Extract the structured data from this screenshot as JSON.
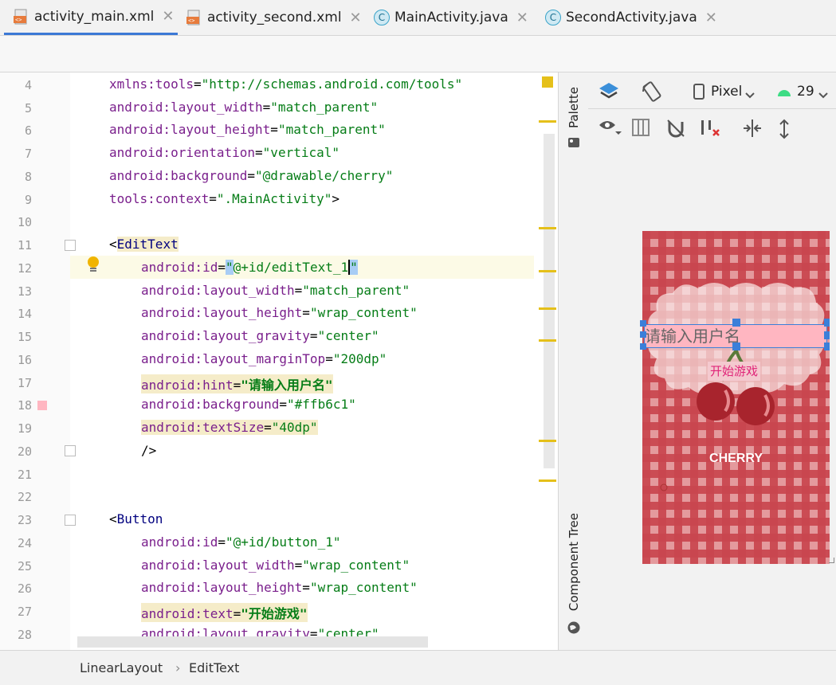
{
  "tabs": [
    {
      "label": "activity_main.xml",
      "icon": "xml-file-icon",
      "active": true
    },
    {
      "label": "activity_second.xml",
      "icon": "xml-file-icon",
      "active": false
    },
    {
      "label": "MainActivity.java",
      "icon": "java-class-icon",
      "active": false
    },
    {
      "label": "SecondActivity.java",
      "icon": "java-class-icon",
      "active": false
    }
  ],
  "tab_close": "✕",
  "class_glyph": "C",
  "line_numbers": [
    "4",
    "5",
    "6",
    "7",
    "8",
    "9",
    "10",
    "11",
    "12",
    "13",
    "14",
    "15",
    "16",
    "17",
    "18",
    "19",
    "20",
    "21",
    "22",
    "23",
    "24",
    "25",
    "26",
    "27",
    "28"
  ],
  "code": {
    "l4_attr": "xmlns:tools",
    "l4_val": "\"http://schemas.android.com/tools\"",
    "l5_attr": "android:layout_width",
    "l5_val": "\"match_parent\"",
    "l6_attr": "android:layout_height",
    "l6_val": "\"match_parent\"",
    "l7_attr": "android:orientation",
    "l7_val": "\"vertical\"",
    "l8_attr": "android:background",
    "l8_val": "\"@drawable/cherry\"",
    "l9_attr": "tools:context",
    "l9_val": "\".MainActivity\"",
    "l9_end": ">",
    "l11_open": "<",
    "l11_tag": "EditText",
    "l12_attr": "android:id",
    "l12_q1": "\"",
    "l12_val": "@+id/editText_1",
    "l12_q2": "\"",
    "l13_attr": "android:layout_width",
    "l13_val": "\"match_parent\"",
    "l14_attr": "android:layout_height",
    "l14_val": "\"wrap_content\"",
    "l15_attr": "android:layout_gravity",
    "l15_val": "\"center\"",
    "l16_attr": "android:layout_marginTop",
    "l16_val": "\"200dp\"",
    "l17_attr": "android:hint",
    "l17_val": "\"请输入用户名\"",
    "l18_attr": "android:background",
    "l18_val": "\"#ffb6c1\"",
    "l19_attr": "android:textSize",
    "l19_val": "\"40dp\"",
    "l20_close": "/>",
    "l23_open": "<",
    "l23_tag": "Button",
    "l24_attr": "android:id",
    "l24_val": "\"@+id/button_1\"",
    "l25_attr": "android:layout_width",
    "l25_val": "\"wrap_content\"",
    "l26_attr": "android:layout_height",
    "l26_val": "\"wrap_content\"",
    "l27_attr": "android:text",
    "l27_val": "\"开始游戏\"",
    "l28_attr": "android:layout_gravity",
    "l28_val": "\"center\"",
    "eq": "="
  },
  "sidebar": {
    "palette": "Palette",
    "component_tree": "Component Tree"
  },
  "design_toolbar": {
    "device": "Pixel",
    "api": "29"
  },
  "preview": {
    "edittext_hint": "请输入用户名",
    "button_text": "开始游戏",
    "brand": "CHERRY",
    "edittext_bg": "#ffb6c1",
    "gingham_color": "#c8454d"
  },
  "breadcrumb": [
    "LinearLayout",
    "EditText"
  ],
  "breadcrumb_sep": "›"
}
